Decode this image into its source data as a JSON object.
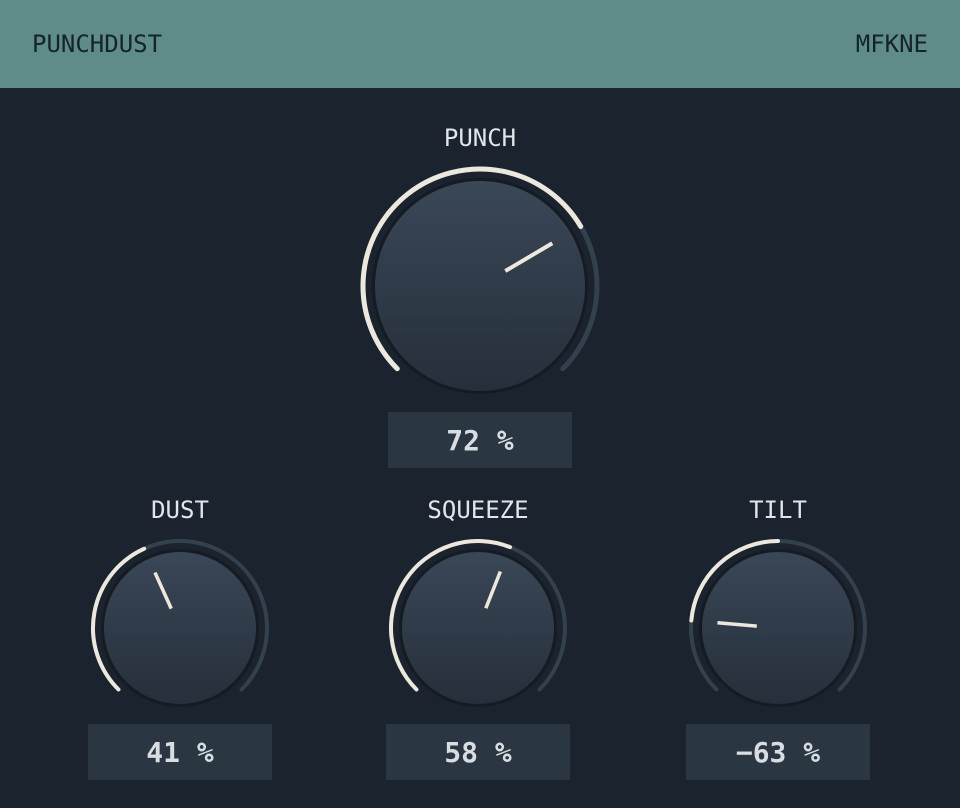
{
  "header": {
    "title": "PUNCHDUST",
    "brand": "MFKNE"
  },
  "colors": {
    "header_bg": "#5f8c88",
    "panel_bg": "#1b232e",
    "arc_active": "#ece8de",
    "arc_track": "#33414e",
    "knob_top": "#3a4757",
    "knob_bottom": "#262f3b",
    "value_bg": "#2a3642"
  },
  "knobs": [
    {
      "id": "punch",
      "label": "PUNCH",
      "value_text": "72 %",
      "level": 0.72,
      "bipolar": false
    },
    {
      "id": "dust",
      "label": "DUST",
      "value_text": "41 %",
      "level": 0.41,
      "bipolar": false
    },
    {
      "id": "squeeze",
      "label": "SQUEEZE",
      "value_text": "58 %",
      "level": 0.58,
      "bipolar": false
    },
    {
      "id": "tilt",
      "label": "TILT",
      "value_text": "−63 %",
      "level": -0.63,
      "bipolar": true
    }
  ]
}
